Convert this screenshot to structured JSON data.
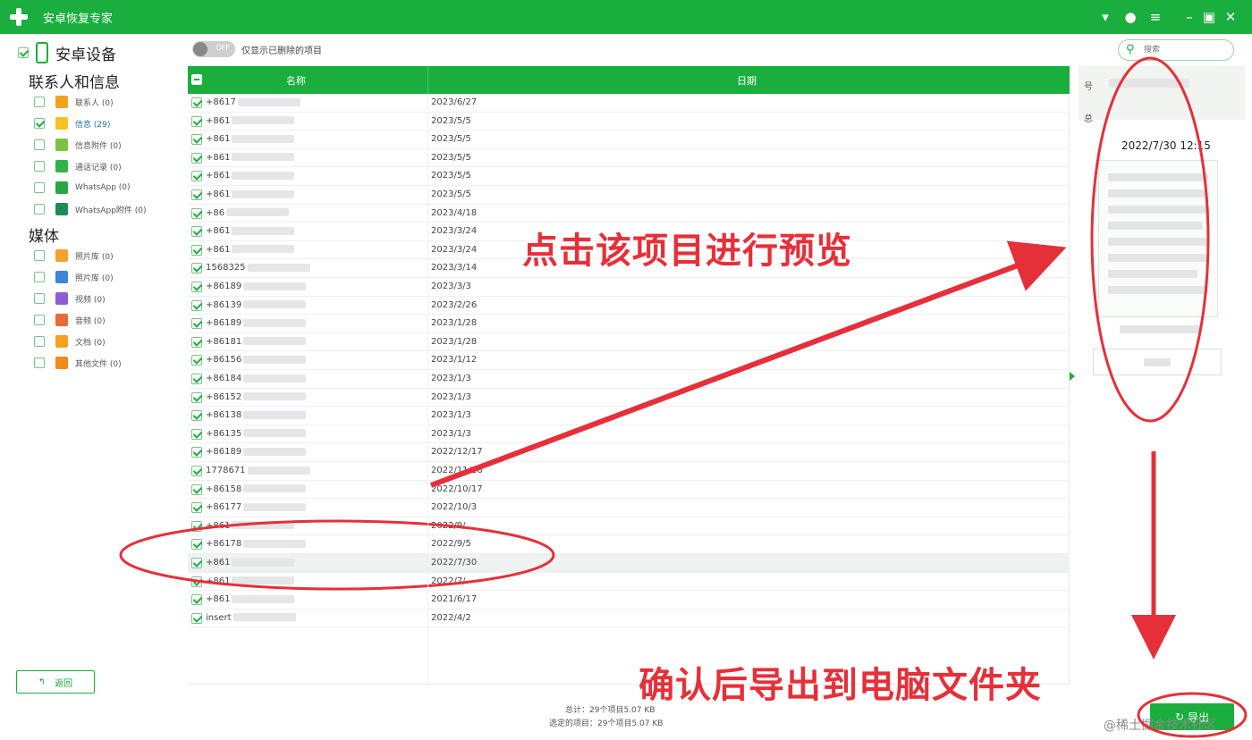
{
  "app": {
    "title": "安卓恢复专家"
  },
  "sidebar": {
    "device": "安卓设备",
    "section_contacts": "联系人和信息",
    "contacts_items": [
      {
        "label": "联系人 (0)",
        "icon": "contacts-icon",
        "color": "#f2a21b",
        "checked": false
      },
      {
        "label": "信息 (29)",
        "icon": "message-icon",
        "color": "#f5c124",
        "checked": true
      },
      {
        "label": "信息附件 (0)",
        "icon": "attachment-icon",
        "color": "#7cc243",
        "checked": false
      },
      {
        "label": "通话记录 (0)",
        "icon": "call-log-icon",
        "color": "#2fb34a",
        "checked": false
      },
      {
        "label": "WhatsApp (0)",
        "icon": "whatsapp-icon",
        "color": "#27a844",
        "checked": false
      },
      {
        "label": "WhatsApp附件 (0)",
        "icon": "whatsapp-attachment-icon",
        "color": "#1f8a5a",
        "checked": false
      }
    ],
    "section_media": "媒体",
    "media_items": [
      {
        "label": "照片库 (0)",
        "icon": "gallery-icon",
        "color": "#f3a32c",
        "checked": false
      },
      {
        "label": "照片库 (0)",
        "icon": "picture-library-icon",
        "color": "#3b86d8",
        "checked": false
      },
      {
        "label": "视频 (0)",
        "icon": "video-icon",
        "color": "#8e5ed8",
        "checked": false
      },
      {
        "label": "音频 (0)",
        "icon": "audio-icon",
        "color": "#e86a3a",
        "checked": false
      },
      {
        "label": "文档 (0)",
        "icon": "document-icon",
        "color": "#f4a21c",
        "checked": false
      },
      {
        "label": "其他文件 (0)",
        "icon": "other-files-icon",
        "color": "#f08a1c",
        "checked": false
      }
    ],
    "back_label": "返回"
  },
  "toolbar": {
    "toggle_text": "OFF",
    "toggle_label": "仅显示已删除的项目",
    "search_placeholder": "搜索"
  },
  "table": {
    "columns": [
      "名称",
      "日期"
    ],
    "rows": [
      {
        "name": "+8617",
        "date": "2023/6/27"
      },
      {
        "name": "+861",
        "date": "2023/5/5"
      },
      {
        "name": "+861",
        "date": "2023/5/5"
      },
      {
        "name": "+861",
        "date": "2023/5/5"
      },
      {
        "name": "+861",
        "date": "2023/5/5"
      },
      {
        "name": "+861",
        "date": "2023/5/5"
      },
      {
        "name": "+86",
        "date": "2023/4/18"
      },
      {
        "name": "+861",
        "date": "2023/3/24"
      },
      {
        "name": "+861",
        "date": "2023/3/24"
      },
      {
        "name": "1568325",
        "date": "2023/3/14"
      },
      {
        "name": "+86189",
        "date": "2023/3/3"
      },
      {
        "name": "+86139",
        "date": "2023/2/26"
      },
      {
        "name": "+86189",
        "date": "2023/1/28"
      },
      {
        "name": "+86181",
        "date": "2023/1/28"
      },
      {
        "name": "+86156",
        "date": "2023/1/12"
      },
      {
        "name": "+86184",
        "date": "2023/1/3"
      },
      {
        "name": "+86152",
        "date": "2023/1/3"
      },
      {
        "name": "+86138",
        "date": "2023/1/3"
      },
      {
        "name": "+86135",
        "date": "2023/1/3"
      },
      {
        "name": "+86189",
        "date": "2022/12/17"
      },
      {
        "name": "1778671",
        "date": "2022/11/16"
      },
      {
        "name": "+86158",
        "date": "2022/10/17"
      },
      {
        "name": "+86177",
        "date": "2022/10/3"
      },
      {
        "name": "+861",
        "date": "2022/9/"
      },
      {
        "name": "+86178",
        "date": "2022/9/5"
      },
      {
        "name": "+861",
        "date": "2022/7/30",
        "selected": true
      },
      {
        "name": "+861",
        "date": "2022/7/"
      },
      {
        "name": "+861",
        "date": "2021/6/17"
      },
      {
        "name": "insert",
        "date": "2022/4/2"
      }
    ]
  },
  "preview": {
    "label_1": "号",
    "label_2": "总",
    "time": "2022/7/30 12:15"
  },
  "footer": {
    "total": "总计：29个项目5.07 KB",
    "selected": "选定的项目：29个项目5.07 KB",
    "export_label": "导出"
  },
  "annotations": {
    "preview_hint": "点击该项目进行预览",
    "export_hint": "确认后导出到电脑文件夹",
    "color": "#e5303a"
  },
  "watermark": "@稀土掘金技术社区"
}
